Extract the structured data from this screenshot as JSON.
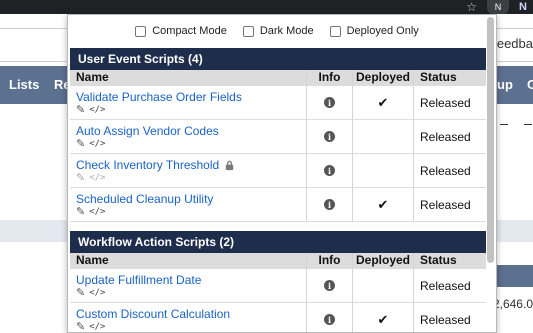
{
  "background": {
    "feed_text": "Feedba",
    "nav_items": [
      "Lists",
      "Re",
      "up",
      "C"
    ],
    "amount_text": "2,646.0"
  },
  "extension": {
    "badge_letter": "N"
  },
  "options": [
    {
      "label": "Compact Mode",
      "checked": false
    },
    {
      "label": "Dark Mode",
      "checked": false
    },
    {
      "label": "Deployed Only",
      "checked": false
    }
  ],
  "columns": {
    "name": "Name",
    "info": "Info",
    "deployed": "Deployed",
    "status": "Status"
  },
  "sections": [
    {
      "title": "User Event Scripts (4)",
      "rows": [
        {
          "name": "Validate Purchase Order Fields",
          "deployed": "✔",
          "status": "Released",
          "locked": false
        },
        {
          "name": "Auto Assign Vendor Codes",
          "deployed": "",
          "status": "Released",
          "locked": false
        },
        {
          "name": "Check Inventory Threshold",
          "deployed": "",
          "status": "Released",
          "locked": true
        },
        {
          "name": "Scheduled Cleanup Utility",
          "deployed": "✔",
          "status": "Released",
          "locked": false
        }
      ]
    },
    {
      "title": "Workflow Action Scripts (2)",
      "rows": [
        {
          "name": "Update Fulfillment Date",
          "deployed": "",
          "status": "Released",
          "locked": false
        },
        {
          "name": "Custom Discount Calculation",
          "deployed": "✔",
          "status": "Released",
          "locked": false
        }
      ]
    }
  ]
}
